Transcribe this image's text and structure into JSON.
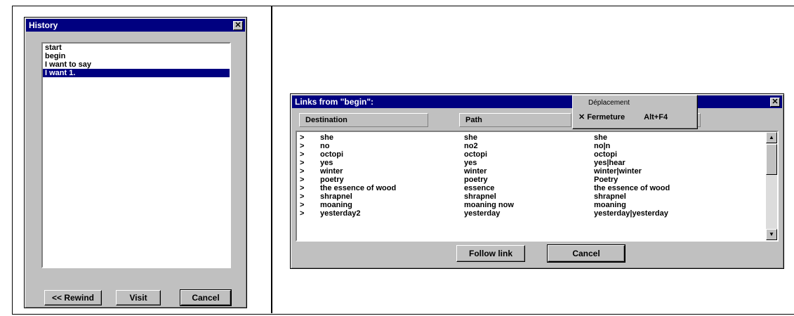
{
  "history_dialog": {
    "title": "History",
    "close_symbol": "✕",
    "items": [
      "start",
      "begin",
      "I want to say",
      "I want 1."
    ],
    "selected_index": 3,
    "buttons": {
      "rewind": "<< Rewind",
      "visit": "Visit",
      "cancel": "Cancel"
    }
  },
  "links_dialog": {
    "title": "Links from \"begin\":",
    "close_symbol": "✕",
    "columns": [
      "Destination",
      "Path",
      ""
    ],
    "rows": [
      {
        "marker": ">",
        "destination": "she",
        "path": "she",
        "third": "she"
      },
      {
        "marker": ">",
        "destination": "no",
        "path": "no2",
        "third": "no|n"
      },
      {
        "marker": ">",
        "destination": "octopi",
        "path": "octopi",
        "third": "octopi"
      },
      {
        "marker": ">",
        "destination": "yes",
        "path": "yes",
        "third": "yes|hear"
      },
      {
        "marker": ">",
        "destination": "winter",
        "path": "winter",
        "third": "winter|winter"
      },
      {
        "marker": ">",
        "destination": "poetry",
        "path": "poetry",
        "third": "Poetry"
      },
      {
        "marker": ">",
        "destination": "the essence of wood",
        "path": "essence",
        "third": "the essence of wood"
      },
      {
        "marker": ">",
        "destination": "shrapnel",
        "path": "shrapnel",
        "third": "shrapnel"
      },
      {
        "marker": ">",
        "destination": "moaning",
        "path": "moaning now",
        "third": "moaning"
      },
      {
        "marker": ">",
        "destination": "yesterday2",
        "path": "yesterday",
        "third": "yesterday|yesterday"
      }
    ],
    "buttons": {
      "follow": "Follow link",
      "cancel": "Cancel"
    },
    "scroll_up": "▲",
    "scroll_down": "▼"
  },
  "system_menu": {
    "items": [
      {
        "label": "Déplacement",
        "shortcut": ""
      },
      {
        "label": "Fermeture",
        "shortcut": "Alt+F4",
        "mark": "✕"
      }
    ]
  },
  "colors": {
    "titlebar": "#000080",
    "face": "#c0c0c0",
    "selection": "#000080"
  }
}
